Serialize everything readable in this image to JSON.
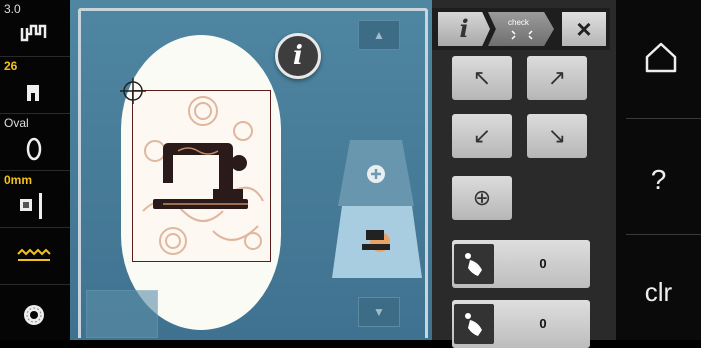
{
  "left_status": {
    "stitch_width": "3.0",
    "presser_foot": "26",
    "hoop": "Oval",
    "needle_position": "0mm"
  },
  "main": {
    "info_label": "i"
  },
  "tool_panel": {
    "info_tab_label": "i",
    "check_tab_label": "check",
    "close_label": "×",
    "arrows": {
      "up_left": "↖",
      "up_right": "↗",
      "down_left": "↙",
      "down_right": "↘"
    },
    "center_label": "⊕",
    "row1_value": "0",
    "row2_value": "0"
  },
  "right_nav": {
    "help_label": "?",
    "clr_label": "clr"
  },
  "colors": {
    "accent_yellow": "#f2c21b",
    "canvas_blue": "#4a7d97",
    "design_border": "#5a1b1b"
  }
}
